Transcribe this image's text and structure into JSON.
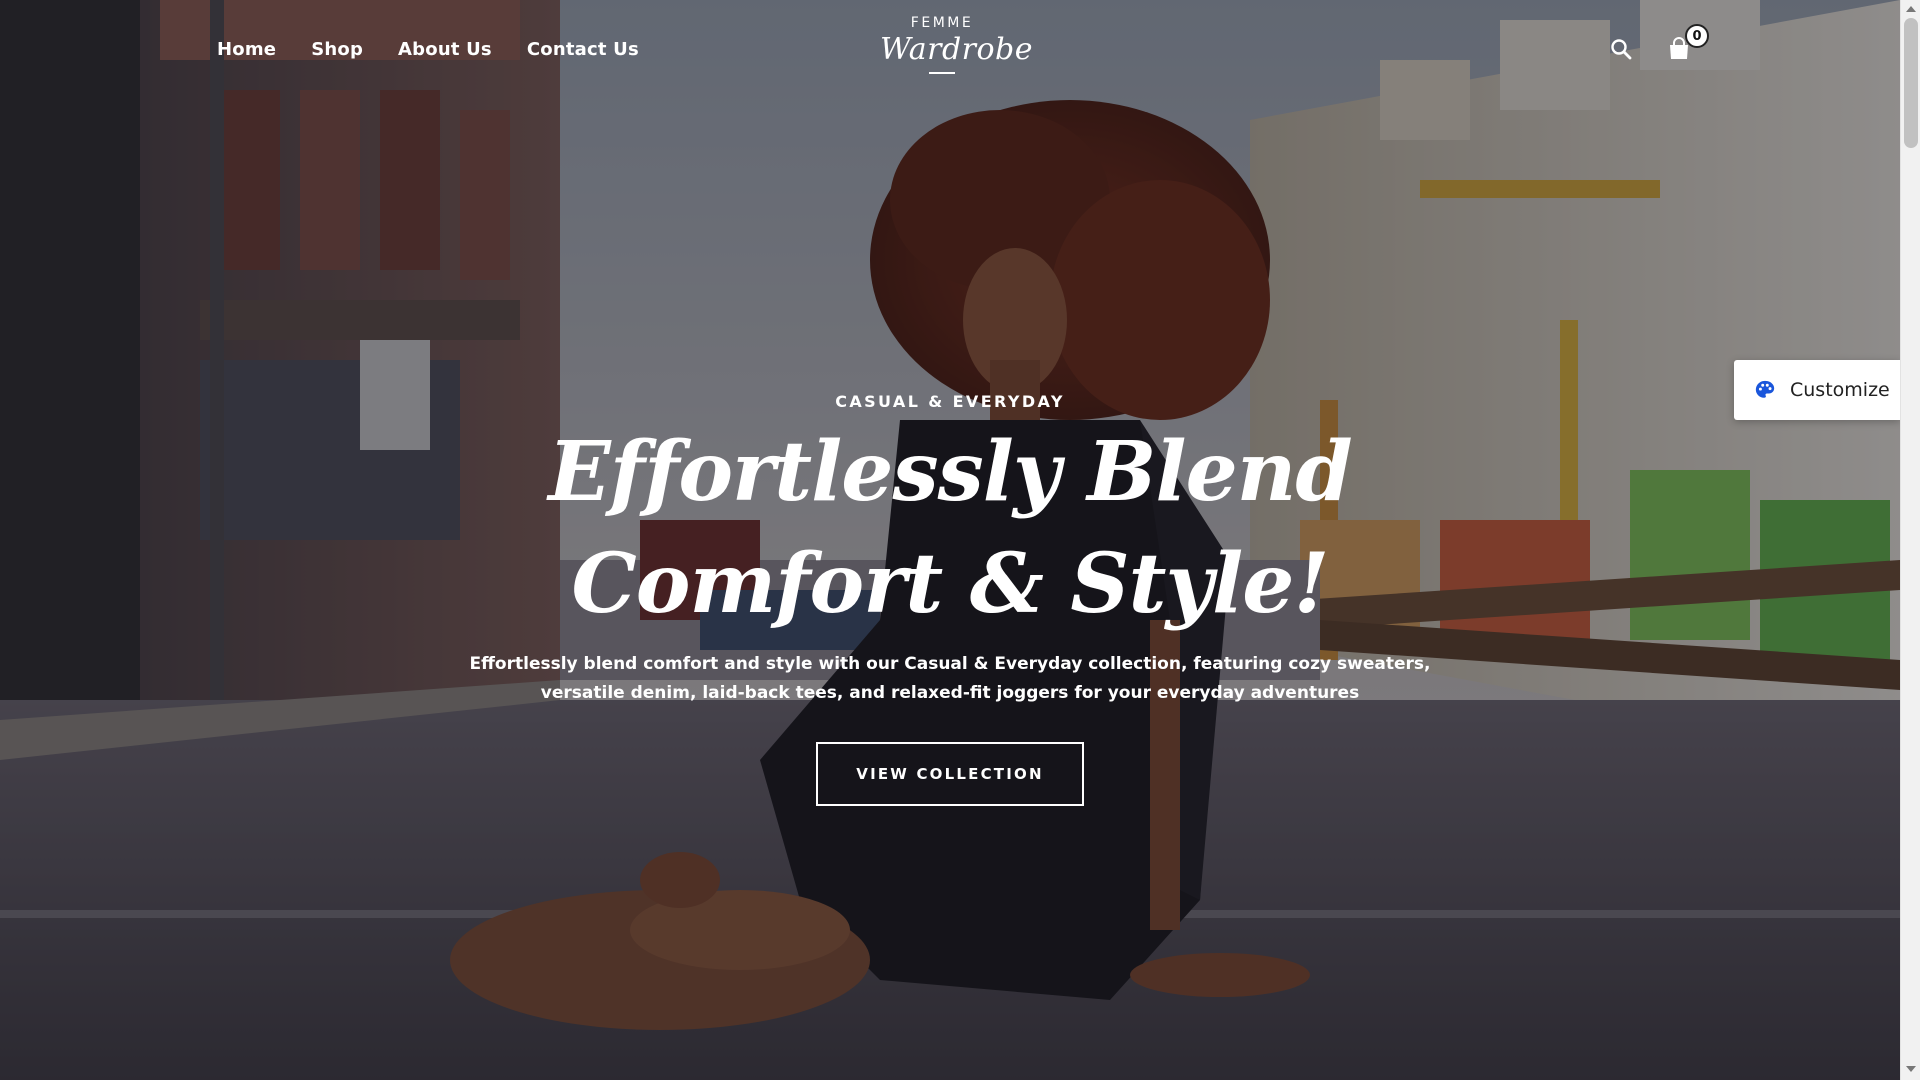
{
  "nav": {
    "items": [
      {
        "label": "Home"
      },
      {
        "label": "Shop"
      },
      {
        "label": "About Us"
      },
      {
        "label": "Contact Us"
      }
    ]
  },
  "logo": {
    "top": "FEMME",
    "main": "Wardrobe"
  },
  "header": {
    "search_icon": "search-icon",
    "cart_icon": "shopping-bag-icon",
    "cart_count": "0"
  },
  "hero": {
    "eyebrow": "CASUAL & EVERYDAY",
    "headline": "Effortlessly Blend Comfort & Style!",
    "description": "Effortlessly blend comfort and style with our Casual & Everyday collection, featuring cozy sweaters, versatile denim, laid-back tees, and relaxed-fit joggers for your everyday adventures",
    "cta_label": "VIEW COLLECTION"
  },
  "customize": {
    "label": "Customize",
    "icon": "palette-icon",
    "icon_color": "#1a56db"
  },
  "colors": {
    "text": "#ffffff",
    "overlay": "#14121a"
  }
}
